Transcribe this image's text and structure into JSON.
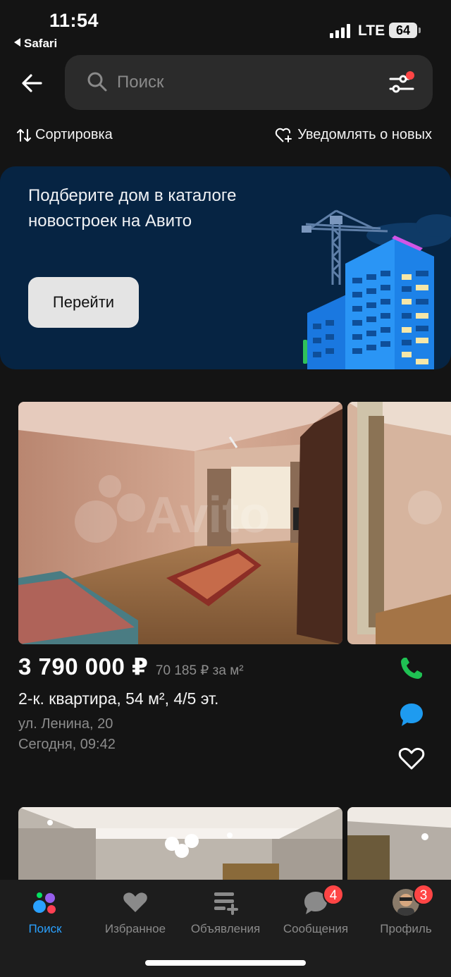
{
  "status_bar": {
    "time": "11:54",
    "back_app": "Safari",
    "network": "LTE",
    "battery": "64"
  },
  "search": {
    "placeholder": "Поиск",
    "filter_has_indicator": true
  },
  "toolbar": {
    "sort_label": "Сортировка",
    "notify_label": "Уведомлять о новых"
  },
  "banner": {
    "text": "Подберите дом в каталоге новостроек на Авито",
    "button_label": "Перейти"
  },
  "listing": {
    "price": "3 790 000 ₽",
    "price_per_m2": "70 185 ₽ за м²",
    "title": "2-к. квартира, 54 м², 4/5 эт.",
    "address": "ул. Ленина, 20",
    "date": "Сегодня, 09:42",
    "watermark": "Avito"
  },
  "tabs": [
    {
      "label": "Поиск",
      "icon": "search-logo-icon",
      "active": true
    },
    {
      "label": "Избранное",
      "icon": "heart-icon"
    },
    {
      "label": "Объявления",
      "icon": "ads-list-icon"
    },
    {
      "label": "Сообщения",
      "icon": "chat-icon",
      "badge": "4"
    },
    {
      "label": "Профиль",
      "icon": "avatar",
      "badge": "3"
    }
  ],
  "colors": {
    "background": "#141414",
    "banner": "#062443",
    "accent_blue": "#2aa1ff",
    "call_green": "#1fc153",
    "message_blue": "#1e9bf0",
    "badge_red": "#ff4545"
  }
}
